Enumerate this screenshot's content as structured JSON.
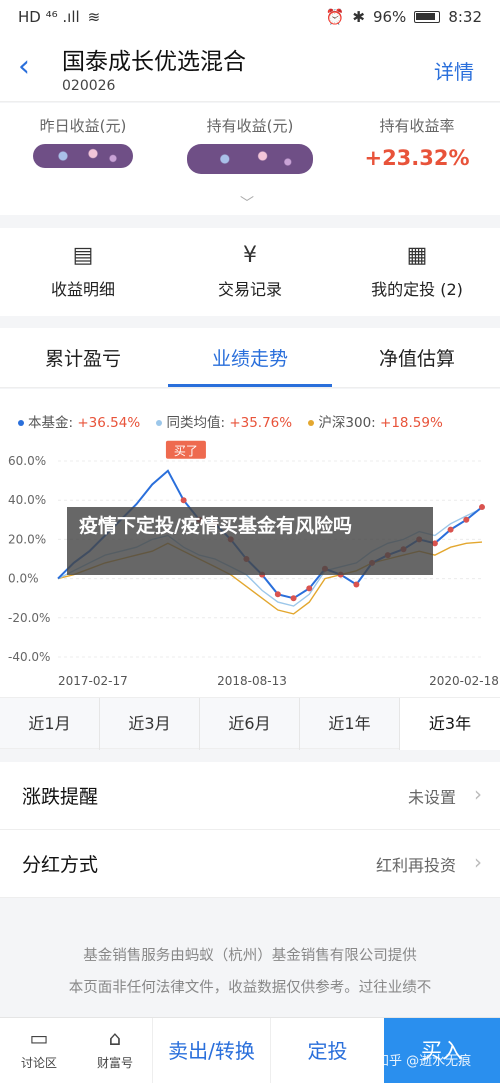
{
  "statusbar": {
    "left": "HD ⁴⁶ .ıll",
    "battery": "96%",
    "time": "8:32"
  },
  "header": {
    "title": "国泰成长优选混合",
    "code": "020026",
    "detail": "详情"
  },
  "earnings": {
    "yesterday_label": "昨日收益(元)",
    "holding_label": "持有收益(元)",
    "rate_label": "持有收益率",
    "rate_value": "+23.32%"
  },
  "quick": {
    "items": [
      {
        "icon": "document-icon",
        "label": "收益明细"
      },
      {
        "icon": "yuan-icon",
        "label": "交易记录"
      },
      {
        "icon": "calendar-icon",
        "label": "我的定投 (2)"
      }
    ]
  },
  "tabs": [
    "累计盈亏",
    "业绩走势",
    "净值估算"
  ],
  "legend": {
    "fund_label": "本基金:",
    "fund_value": "+36.54%",
    "peer_label": "同类均值:",
    "peer_value": "+35.76%",
    "index_label": "沪深300:",
    "index_value": "+18.59%",
    "fund_color": "#2a6fdb",
    "peer_color": "#9cc7ea",
    "index_color": "#e3a72f"
  },
  "chart_data": {
    "type": "line",
    "ylim": [
      -40,
      60
    ],
    "y_ticks": [
      "60.0%",
      "40.0%",
      "20.0%",
      "0.0%",
      "-20.0%",
      "-40.0%"
    ],
    "x_ticks": [
      "2017-02-17",
      "2018-08-13",
      "2020-02-18"
    ],
    "annotation": "买了",
    "series": [
      {
        "name": "本基金",
        "values": [
          0,
          8,
          14,
          22,
          30,
          38,
          48,
          55,
          40,
          30,
          28,
          20,
          10,
          2,
          -8,
          -10,
          -5,
          5,
          2,
          -3,
          8,
          12,
          15,
          20,
          18,
          25,
          30,
          36.5
        ]
      },
      {
        "name": "同类均值",
        "values": [
          0,
          4,
          8,
          12,
          14,
          16,
          20,
          22,
          16,
          12,
          10,
          6,
          2,
          -6,
          -12,
          -14,
          -8,
          4,
          6,
          8,
          14,
          18,
          20,
          24,
          22,
          28,
          32,
          35.8
        ]
      },
      {
        "name": "沪深300",
        "values": [
          0,
          2,
          5,
          8,
          10,
          12,
          14,
          18,
          14,
          10,
          6,
          2,
          -4,
          -10,
          -16,
          -18,
          -12,
          0,
          2,
          4,
          8,
          10,
          12,
          14,
          12,
          16,
          18,
          18.6
        ]
      }
    ]
  },
  "ranges": [
    "近1月",
    "近3月",
    "近6月",
    "近1年",
    "近3年"
  ],
  "rows": [
    {
      "label": "涨跌提醒",
      "value": "未设置"
    },
    {
      "label": "分红方式",
      "value": "红利再投资"
    }
  ],
  "footer": {
    "line1": "基金销售服务由蚂蚁（杭州）基金销售有限公司提供",
    "line2": "本页面非任何法律文件，收益数据仅供参考。过往业绩不"
  },
  "bottombar": {
    "discuss": "讨论区",
    "fortune": "财富号",
    "sell": "卖出/转换",
    "fixed": "定投",
    "buy": "买入"
  },
  "overlay": {
    "text": "疫情下定投/疫情买基金有风险吗"
  },
  "watermark": "知乎 @逝水无痕"
}
